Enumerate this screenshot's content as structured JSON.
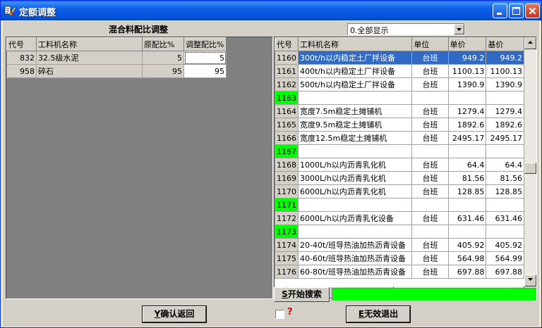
{
  "window": {
    "title": "定额调整",
    "icon": "app-icon",
    "controls": [
      "minimize-icon",
      "maximize-icon",
      "close-icon"
    ]
  },
  "left": {
    "title": "混合料配比调整",
    "columns": [
      "代号",
      "工料机名称",
      "原配比%",
      "调整配比%"
    ],
    "rows": [
      {
        "code": "832",
        "name": "32.5级水泥",
        "orig": "5",
        "adj": "5"
      },
      {
        "code": "958",
        "name": "碎石",
        "orig": "95",
        "adj": "95"
      }
    ]
  },
  "right": {
    "filter": {
      "selected": "0.全部显示"
    },
    "columns": [
      "代号",
      "工料机名称",
      "单位",
      "单价",
      "基价"
    ],
    "rows": [
      {
        "code": "1160",
        "name": "300t/h以内稳定土厂拌设备",
        "unit": "台班",
        "price": "949.2",
        "base": "949.2",
        "selected": true
      },
      {
        "code": "1161",
        "name": "400t/h以内稳定土厂拌设备",
        "unit": "台班",
        "price": "1100.13",
        "base": "1100.13"
      },
      {
        "code": "1162",
        "name": "500t/h以内稳定土厂拌设备",
        "unit": "台班",
        "price": "1390.9",
        "base": "1390.9"
      },
      {
        "code": "1163",
        "name": "",
        "unit": "",
        "price": "",
        "base": "",
        "green": true
      },
      {
        "code": "1164",
        "name": "宽度7.5m稳定土摊铺机",
        "unit": "台班",
        "price": "1279.4",
        "base": "1279.4"
      },
      {
        "code": "1165",
        "name": "宽度9.5m稳定土摊铺机",
        "unit": "台班",
        "price": "1892.6",
        "base": "1892.6"
      },
      {
        "code": "1166",
        "name": "宽度12.5m稳定土摊铺机",
        "unit": "台班",
        "price": "2495.17",
        "base": "2495.17"
      },
      {
        "code": "1167",
        "name": "",
        "unit": "",
        "price": "",
        "base": "",
        "green": true
      },
      {
        "code": "1168",
        "name": "1000L/h以内沥青乳化机",
        "unit": "台班",
        "price": "64.4",
        "base": "64.4"
      },
      {
        "code": "1169",
        "name": "3000L/h以内沥青乳化机",
        "unit": "台班",
        "price": "81.56",
        "base": "81.56"
      },
      {
        "code": "1170",
        "name": "6000L/h以内沥青乳化机",
        "unit": "台班",
        "price": "128.85",
        "base": "128.85"
      },
      {
        "code": "1171",
        "name": "",
        "unit": "",
        "price": "",
        "base": "",
        "green": true
      },
      {
        "code": "1172",
        "name": "6000L/h以内沥青乳化设备",
        "unit": "台班",
        "price": "631.46",
        "base": "631.46"
      },
      {
        "code": "1173",
        "name": "",
        "unit": "",
        "price": "",
        "base": "",
        "green": true
      },
      {
        "code": "1174",
        "name": "20-40t/班导热油加热沥青设备",
        "unit": "台班",
        "price": "405.92",
        "base": "405.92"
      },
      {
        "code": "1175",
        "name": "40-60t/班导热油加热沥青设备",
        "unit": "台班",
        "price": "564.98",
        "base": "564.99"
      },
      {
        "code": "1176",
        "name": "60-80t/班导热油加热沥青设备",
        "unit": "台班",
        "price": "697.88",
        "base": "697.88"
      }
    ]
  },
  "search": {
    "key": "S",
    "label": "开始搜索"
  },
  "confirm": {
    "key": "Y",
    "label": "确认返回"
  },
  "exit": {
    "key": "E",
    "label": "无效退出"
  },
  "help_mark": "?"
}
